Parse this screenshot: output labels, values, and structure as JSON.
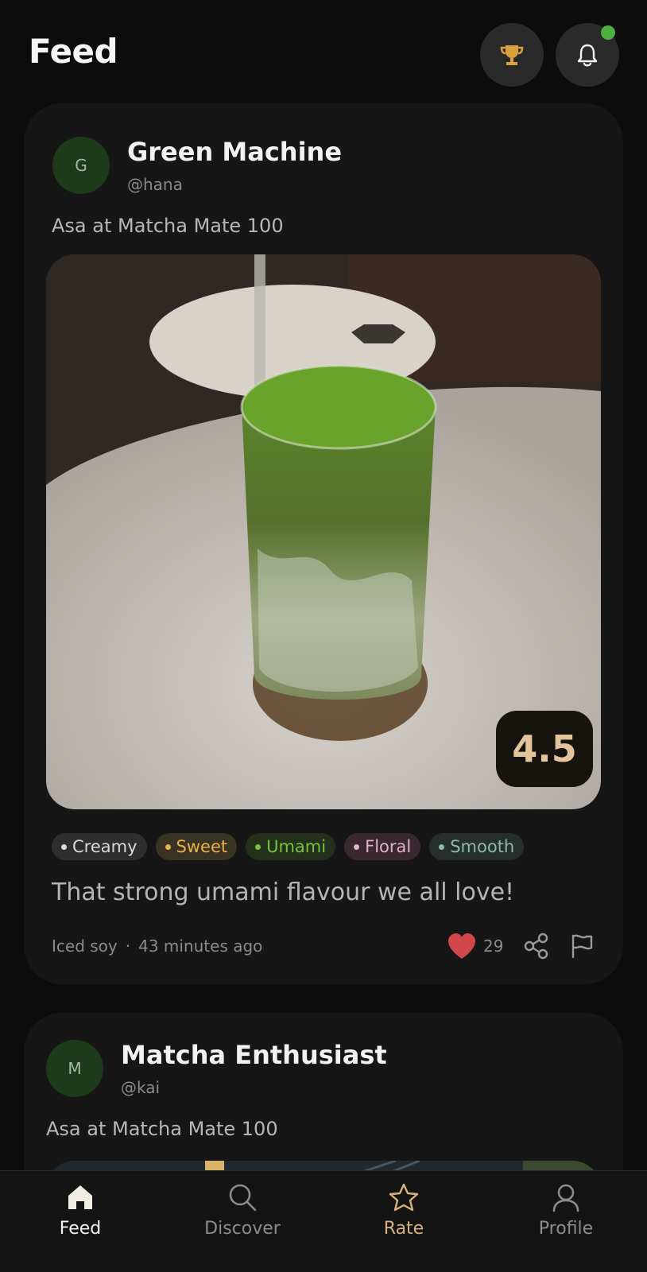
{
  "header": {
    "title": "Feed",
    "trophy_icon": "trophy-icon",
    "bell_icon": "bell-icon",
    "has_notification": true,
    "accent": "#d9a23c"
  },
  "posts": [
    {
      "avatar_letter": "G",
      "display_name": "Green Machine",
      "handle": "@hana",
      "location": "Asa at Matcha Mate 100",
      "score": "4.5",
      "tags": [
        {
          "label": "Creamy",
          "color": "#d9d9d9",
          "bg": "#2e2e2e"
        },
        {
          "label": "Sweet",
          "color": "#e6b24e",
          "bg": "#3a3222"
        },
        {
          "label": "Umami",
          "color": "#7bc043",
          "bg": "#23311c"
        },
        {
          "label": "Floral",
          "color": "#e0b3c6",
          "bg": "#3a2830"
        },
        {
          "label": "Smooth",
          "color": "#8fb8a8",
          "bg": "#25302c"
        }
      ],
      "review": "That strong umami flavour we all love!",
      "milk": "Iced soy",
      "separator": "·",
      "time_ago": "43 minutes ago",
      "likes": "29",
      "liked": true
    },
    {
      "avatar_letter": "M",
      "display_name": "Matcha Enthusiast",
      "handle": "@kai",
      "location": "Asa at Matcha Mate 100"
    }
  ],
  "tabbar": {
    "tabs": [
      {
        "label": "Feed",
        "icon": "home-icon",
        "active": true
      },
      {
        "label": "Discover",
        "icon": "search-icon",
        "active": false
      },
      {
        "label": "Rate",
        "icon": "star-icon",
        "active": false
      },
      {
        "label": "Profile",
        "icon": "user-icon",
        "active": false
      }
    ]
  }
}
